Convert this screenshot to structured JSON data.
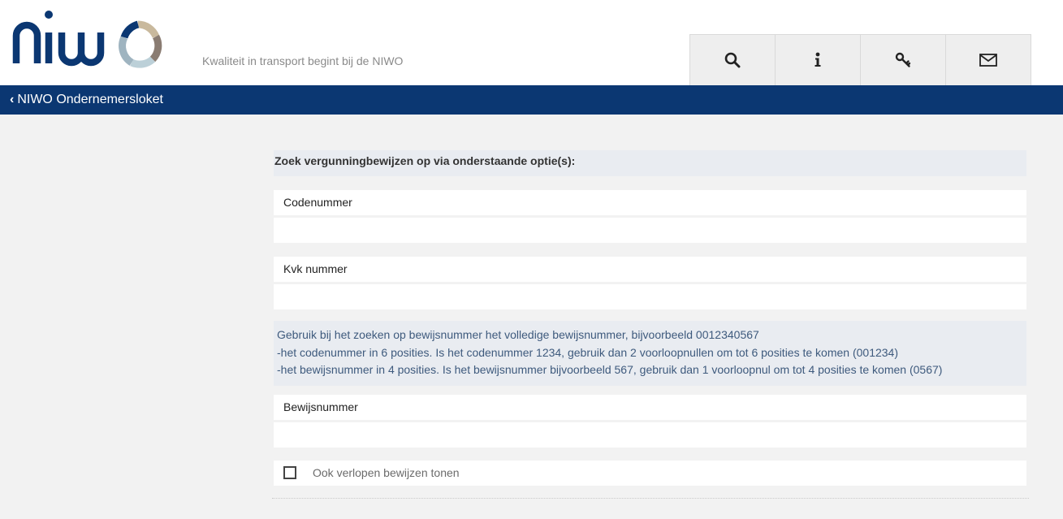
{
  "header": {
    "logo_text": "niwo",
    "tagline": "Kwaliteit in transport begint bij de NIWO"
  },
  "toolbar": {
    "buttons": [
      {
        "icon": "search-icon",
        "label": ""
      },
      {
        "icon": "info-icon",
        "label": ""
      },
      {
        "icon": "key-icon",
        "label": ""
      },
      {
        "icon": "mail-icon",
        "label": ""
      }
    ]
  },
  "nav": {
    "back_label": "NIWO Ondernemersloket"
  },
  "form": {
    "intro": "Zoek vergunningbewijzen op via onderstaande optie(s):",
    "codenummer": {
      "label": "Codenummer",
      "value": "",
      "placeholder": ""
    },
    "kvk": {
      "label": "Kvk nummer",
      "value": "",
      "placeholder": ""
    },
    "help_lines": [
      "Gebruik bij het zoeken op bewijsnummer het volledige bewijsnummer, bijvoorbeeld 0012340567",
      "-het codenummer in 6 posities. Is het codenummer 1234, gebruik dan 2 voorloopnullen om tot 6 posities te komen (001234)",
      "-het bewijsnummer in 4 posities. Is het bewijsnummer bijvoorbeeld 567, gebruik dan 1 voorloopnul om tot 4 posities te komen (0567)"
    ],
    "bewijsnummer": {
      "label": "Bewijsnummer",
      "value": "",
      "placeholder": ""
    },
    "expired_checkbox": {
      "label": "Ook verlopen bewijzen tonen",
      "checked": false
    }
  },
  "colors": {
    "nav_bar": "#0b3772",
    "logo_blue": "#0b3772",
    "page_bg": "#f2f2f2",
    "panel_bg": "#e9ecf1"
  }
}
